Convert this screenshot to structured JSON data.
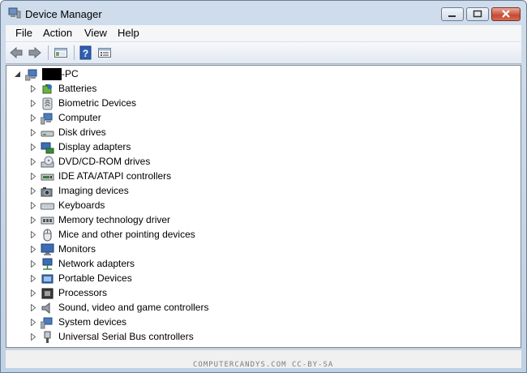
{
  "window": {
    "title": "Device Manager"
  },
  "menu": [
    "File",
    "Action",
    "View",
    "Help"
  ],
  "toolbar": {
    "buttons": [
      {
        "name": "back-arrow-icon"
      },
      {
        "name": "forward-arrow-icon"
      },
      {
        "name": "show-hide-console-tree-icon"
      },
      {
        "name": "help-icon"
      },
      {
        "name": "properties-icon"
      }
    ]
  },
  "tree": {
    "root": {
      "label": "-PC",
      "redacted": true,
      "expanded": true,
      "icon": "computer-icon"
    },
    "items": [
      {
        "label": "Batteries",
        "icon": "battery-icon"
      },
      {
        "label": "Biometric Devices",
        "icon": "fingerprint-icon"
      },
      {
        "label": "Computer",
        "icon": "computer-icon"
      },
      {
        "label": "Disk drives",
        "icon": "disk-drive-icon"
      },
      {
        "label": "Display adapters",
        "icon": "display-adapter-icon"
      },
      {
        "label": "DVD/CD-ROM drives",
        "icon": "optical-drive-icon"
      },
      {
        "label": "IDE ATA/ATAPI controllers",
        "icon": "ide-controller-icon"
      },
      {
        "label": "Imaging devices",
        "icon": "camera-icon"
      },
      {
        "label": "Keyboards",
        "icon": "keyboard-icon"
      },
      {
        "label": "Memory technology driver",
        "icon": "memory-icon"
      },
      {
        "label": "Mice and other pointing devices",
        "icon": "mouse-icon"
      },
      {
        "label": "Monitors",
        "icon": "monitor-icon"
      },
      {
        "label": "Network adapters",
        "icon": "network-adapter-icon"
      },
      {
        "label": "Portable Devices",
        "icon": "portable-device-icon"
      },
      {
        "label": "Processors",
        "icon": "processor-icon"
      },
      {
        "label": "Sound, video and game controllers",
        "icon": "speaker-icon"
      },
      {
        "label": "System devices",
        "icon": "system-device-icon"
      },
      {
        "label": "Universal Serial Bus controllers",
        "icon": "usb-icon"
      }
    ]
  },
  "watermark": "COMPUTERCANDYS.COM CC-BY-SA",
  "colors": {
    "title_bar": "#c9d9ec",
    "close_button": "#c74a34",
    "toolbar": "#e9eef5"
  }
}
